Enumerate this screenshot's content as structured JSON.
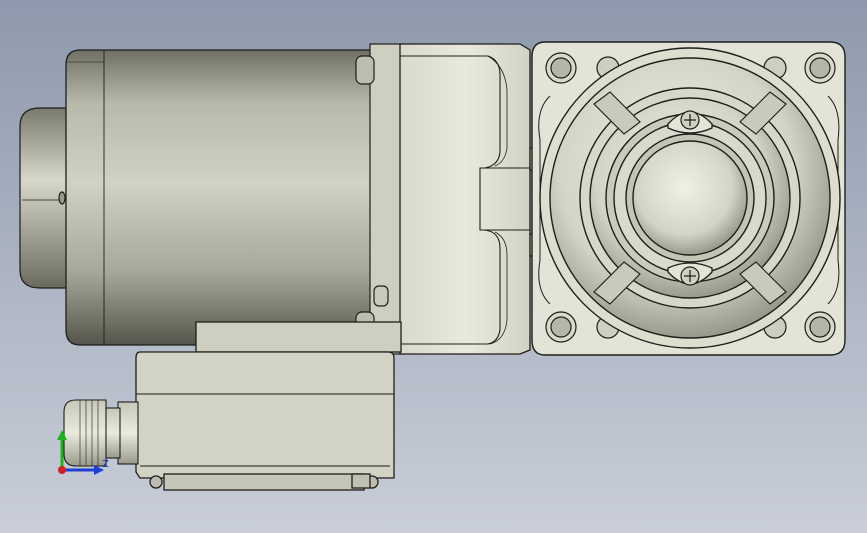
{
  "viewport": {
    "background_top": "#8e99ad",
    "background_bottom": "#c9ced8"
  },
  "triad": {
    "z_label": "Z",
    "x_color": "#d21f1f",
    "y_color": "#1fb31f",
    "z_color": "#1f3fd2"
  },
  "icons": [
    "screw-cross-icon"
  ],
  "colors": {
    "metal_light": "#e6e6d9",
    "metal_mid": "#c8c8b8",
    "metal_dark": "#8c8c7c",
    "edge": "#1e1e1a"
  }
}
